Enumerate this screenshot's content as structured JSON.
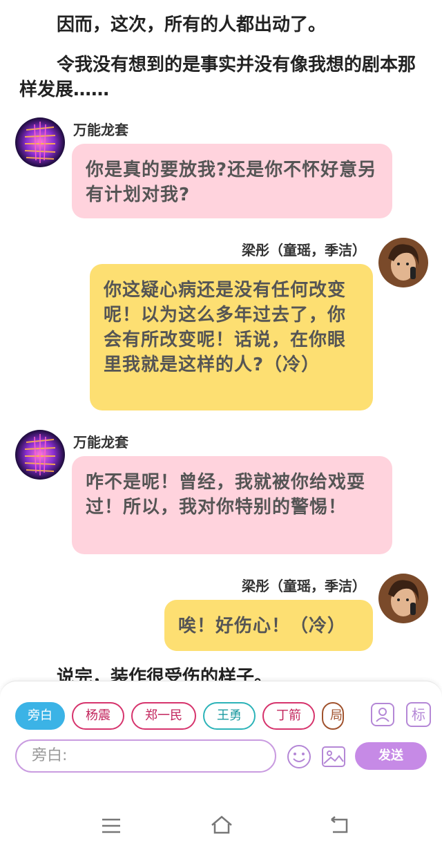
{
  "narration": [
    "因而，这次，所有的人都出动了。",
    "令我没有想到的是事实并没有像我想的剧本那样发展……",
    "说完，装作很受伤的样子。"
  ],
  "messages": [
    {
      "side": "left",
      "speaker": "万能龙套",
      "text": "你是真的要放我?还是你不怀好意另有计划对我?"
    },
    {
      "side": "right",
      "speaker": "梁彤（童瑶，季洁）",
      "text": "你这疑心病还是没有任何改变呢！以为这么多年过去了，你会有所改变呢！话说，在你眼里我就是这样的人?（冷）"
    },
    {
      "side": "left",
      "speaker": "万能龙套",
      "text": "咋不是呢！曾经，我就被你给戏耍过！所以，我对你特别的警惕！"
    },
    {
      "side": "right",
      "speaker": "梁彤（童瑶，季洁）",
      "text": "唉！好伤心！（冷）"
    }
  ],
  "chips": [
    "旁白",
    "杨震",
    "郑一民",
    "王勇",
    "丁箭",
    "局"
  ],
  "toolbar": {
    "contact_icon": "person-card-icon",
    "tag_label": "标",
    "input_placeholder": "旁白:",
    "emoji_icon": "smiley-icon",
    "image_icon": "image-icon",
    "send_label": "发送"
  },
  "nav": {
    "menu_icon": "menu-icon",
    "home_icon": "home-icon",
    "back_icon": "back-icon"
  },
  "colors": {
    "left_bubble": "#ffd3dd",
    "right_bubble": "#fddf72",
    "accent": "#c68ae6",
    "active_chip": "#3bb3e6"
  }
}
